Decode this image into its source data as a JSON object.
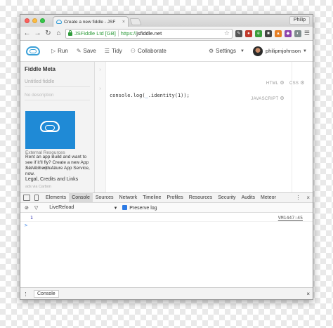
{
  "browser": {
    "tab_title": "Create a new fiddle - JSF",
    "tab_close": "×",
    "profile_name": "Philip",
    "omnibox": {
      "cert_label": "JSFiddle Ltd [GB]",
      "url_proto": "https://",
      "url_host": "jsfiddle.net"
    }
  },
  "jsfiddle": {
    "run_label": "Run",
    "save_label": "Save",
    "tidy_label": "Tidy",
    "collaborate_label": "Collaborate",
    "settings_label": "Settings",
    "username": "philipmjohnson"
  },
  "sidebar": {
    "title": "Fiddle Meta",
    "title_placeholder": "Untitled fiddle",
    "description_placeholder": "No description",
    "external_resources": "External Resources",
    "ad_text": "Rent an app Build and want to see if it'll fly? Create a new App Service with Azure App Service, now.",
    "ajax_requests": "AJAX Requests",
    "legal": "Legal, Credits and Links",
    "carbon": "ads via Carbon"
  },
  "editor": {
    "html_label": "HTML",
    "css_label": "CSS",
    "js_label": "JAVASCRIPT",
    "line_number": "1",
    "code_prefix": "console.log(",
    "code_middle": "_",
    "code_suffix": ".identity(1));"
  },
  "devtools": {
    "tabs": [
      "Elements",
      "Console",
      "Sources",
      "Network",
      "Timeline",
      "Profiles",
      "Resources",
      "Security",
      "Audits",
      "Meteor"
    ],
    "active_tab": "Console",
    "context_select": "LiveReload",
    "preserve_log": "Preserve log",
    "log_value": "1",
    "log_source": "VM1447:45",
    "prompt": ">",
    "drawer_tab": "Console",
    "close_glyph": "×"
  }
}
